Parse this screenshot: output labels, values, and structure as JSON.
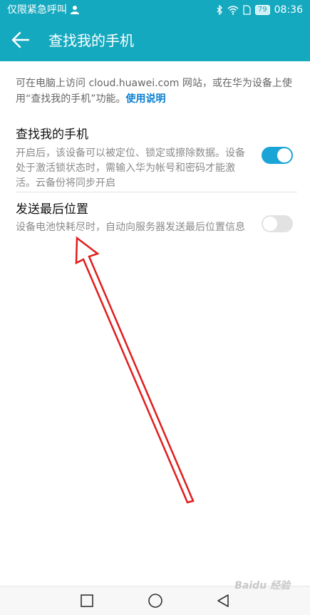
{
  "status_bar": {
    "left_text": "仅限紧急呼叫",
    "person_icon": "person-icon",
    "battery": "79",
    "time": "08:36"
  },
  "app_bar": {
    "title": "查找我的手机",
    "back_icon": "arrow-left-icon"
  },
  "intro": {
    "text": "可在电脑上访问 cloud.huawei.com 网站，或在华为设备上使用“查找我的手机”功能。",
    "link": "使用说明"
  },
  "settings": [
    {
      "title": "查找我的手机",
      "description": "开启后，该设备可以被定位、锁定或擦除数据。设备处于激活锁状态时，需输入华为帐号和密码才能激活。云备份将同步开启",
      "enabled": true
    },
    {
      "title": "发送最后位置",
      "description": "设备电池快耗尽时，自动向服务器发送最后位置信息",
      "enabled": false
    }
  ],
  "colors": {
    "accent": "#15a9bf",
    "toggle_on": "#1aa5d6",
    "toggle_off": "#e2e2e2",
    "annotation_arrow": "#e11d1d"
  },
  "nav_bar": [
    "square-icon",
    "circle-icon",
    "triangle-back-icon"
  ],
  "watermark": "Baidu 经验"
}
